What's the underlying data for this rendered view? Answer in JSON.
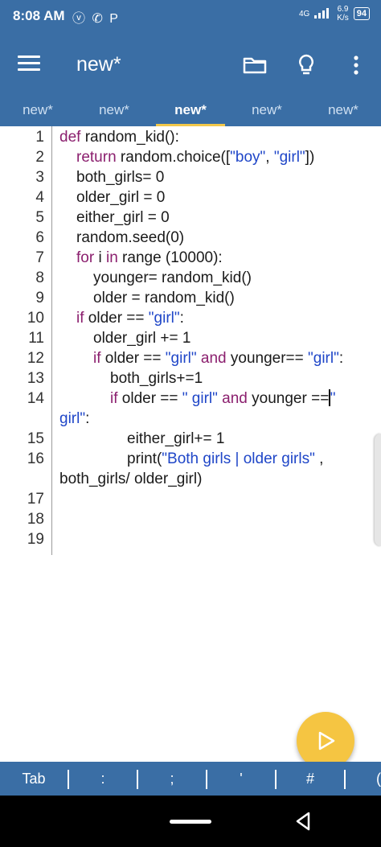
{
  "status_bar": {
    "time": "8:08 AM",
    "notification_icons": "ⓥ ✆ P",
    "network": "4G",
    "speed_value": "6.9",
    "speed_unit": "K/s",
    "battery": "94"
  },
  "toolbar": {
    "title": "new*"
  },
  "tabs": [
    {
      "label": "new*",
      "active": false
    },
    {
      "label": "new*",
      "active": false
    },
    {
      "label": "new*",
      "active": true
    },
    {
      "label": "new*",
      "active": false
    },
    {
      "label": "new*",
      "active": false
    }
  ],
  "editor": {
    "line_numbers": [
      "1",
      "2",
      "3",
      "4",
      "5",
      "6",
      "7",
      "8",
      "9",
      "10",
      "11",
      "12",
      "13",
      "14",
      "15",
      "16",
      "17",
      "18",
      "19"
    ],
    "code": {
      "l1_kw": "def",
      "l1_rest": " random_kid():",
      "l2_kw": "return",
      "l2_a": " random.choice([",
      "l2_s1": "\"boy\"",
      "l2_b": ", ",
      "l2_s2": "\"girl\"",
      "l2_c": "])",
      "l3": "both_girls= 0",
      "l4": "older_girl = 0",
      "l5": "either_girl = 0",
      "l6": "random.seed(0)",
      "l7_kw1": "for",
      "l7_a": " i ",
      "l7_kw2": "in",
      "l7_b": " range (10000):",
      "l8": "younger= random_kid()",
      "l9": "older = random_kid()",
      "l10_kw": "if",
      "l10_a": " older == ",
      "l10_s": "\"girl\"",
      "l10_b": ":",
      "l11": "older_girl += 1",
      "l12_kw": "if",
      "l12_a": " older == ",
      "l12_s1": "\"girl\"",
      "l12_kw2": " and",
      "l12_b": " younger== ",
      "l12_s2": "\"girl\"",
      "l12_c": ":",
      "l13": "both_girls+=1",
      "l14_kw": "if",
      "l14_a": " older == ",
      "l14_s1": "\" girl\"",
      "l14_kw2": " and",
      "l14_b": " younger ==",
      "l14_s2": "\"",
      "l14w_s": "girl\"",
      "l14w_c": ":",
      "l15": "either_girl+= 1",
      "l16_a": "print(",
      "l16_s": "\"Both girls | older girls\"",
      "l16_b": " ,",
      "l16w": "both_girls/ older_girl)"
    }
  },
  "key_bar": {
    "keys": [
      "Tab",
      ":",
      ";",
      "'",
      "#",
      "("
    ]
  }
}
